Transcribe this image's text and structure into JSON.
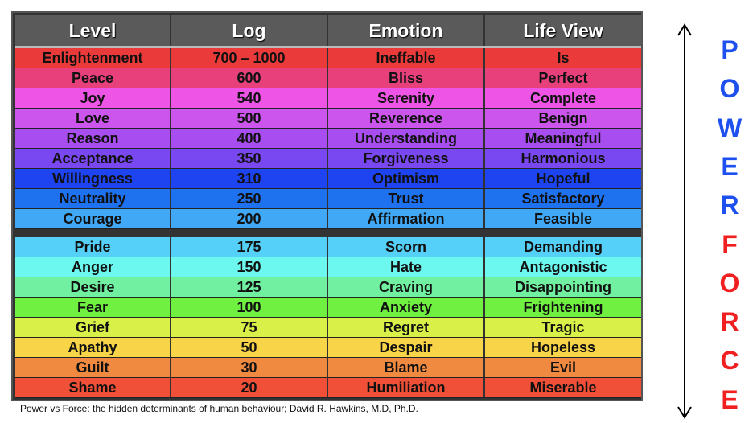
{
  "headers": [
    "Level",
    "Log",
    "Emotion",
    "Life View"
  ],
  "power_rows": [
    {
      "level": "Enlightenment",
      "log": "700 – 1000",
      "emotion": "Ineffable",
      "view": "Is",
      "color": "#ea3a3a"
    },
    {
      "level": "Peace",
      "log": "600",
      "emotion": "Bliss",
      "view": "Perfect",
      "color": "#e8407a"
    },
    {
      "level": "Joy",
      "log": "540",
      "emotion": "Serenity",
      "view": "Complete",
      "color": "#ee55e6"
    },
    {
      "level": "Love",
      "log": "500",
      "emotion": "Reverence",
      "view": "Benign",
      "color": "#cc55ee"
    },
    {
      "level": "Reason",
      "log": "400",
      "emotion": "Understanding",
      "view": "Meaningful",
      "color": "#a84ef0"
    },
    {
      "level": "Acceptance",
      "log": "350",
      "emotion": "Forgiveness",
      "view": "Harmonious",
      "color": "#7a48f0"
    },
    {
      "level": "Willingness",
      "log": "310",
      "emotion": "Optimism",
      "view": "Hopeful",
      "color": "#1e44f2"
    },
    {
      "level": "Neutrality",
      "log": "250",
      "emotion": "Trust",
      "view": "Satisfactory",
      "color": "#1e72f0"
    },
    {
      "level": "Courage",
      "log": "200",
      "emotion": "Affirmation",
      "view": "Feasible",
      "color": "#40a8f5"
    }
  ],
  "force_rows": [
    {
      "level": "Pride",
      "log": "175",
      "emotion": "Scorn",
      "view": "Demanding",
      "color": "#55d0f8"
    },
    {
      "level": "Anger",
      "log": "150",
      "emotion": "Hate",
      "view": "Antagonistic",
      "color": "#6cf8ee"
    },
    {
      "level": "Desire",
      "log": "125",
      "emotion": "Craving",
      "view": "Disappointing",
      "color": "#70f0a0"
    },
    {
      "level": "Fear",
      "log": "100",
      "emotion": "Anxiety",
      "view": "Frightening",
      "color": "#70f040"
    },
    {
      "level": "Grief",
      "log": "75",
      "emotion": "Regret",
      "view": "Tragic",
      "color": "#d8f048"
    },
    {
      "level": "Apathy",
      "log": "50",
      "emotion": "Despair",
      "view": "Hopeless",
      "color": "#f8d448"
    },
    {
      "level": "Guilt",
      "log": "30",
      "emotion": "Blame",
      "view": "Evil",
      "color": "#f08a40"
    },
    {
      "level": "Shame",
      "log": "20",
      "emotion": "Humiliation",
      "view": "Miserable",
      "color": "#f05038"
    }
  ],
  "caption": "Power vs Force: the hidden determinants of human behaviour; David R. Hawkins, M.D, Ph.D.",
  "side_labels": {
    "power": "POWER",
    "force": "FORCE",
    "power_color": "#1e50f0",
    "force_color": "#f02020"
  }
}
